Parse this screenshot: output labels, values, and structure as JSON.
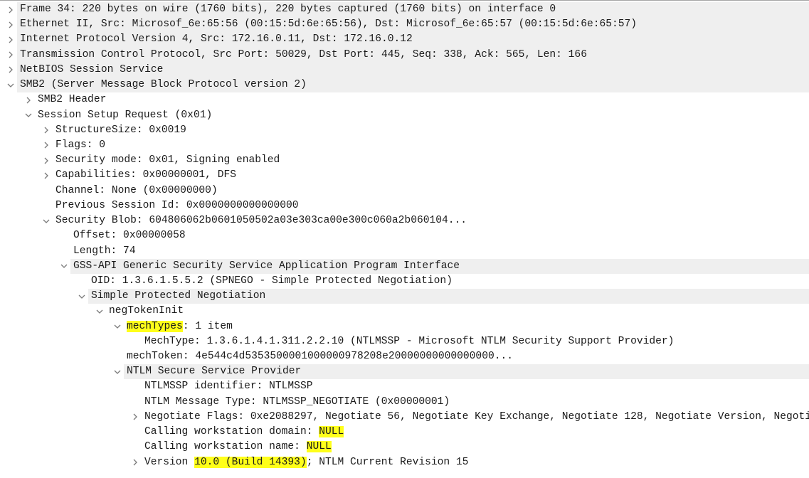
{
  "window": {
    "panel": "packet-details"
  },
  "colors": {
    "protocol_row_bg": "#efefef",
    "highlight": "#ffff1a",
    "text": "#1a1a1a",
    "chevron": "#7a7a7a"
  },
  "icons": {
    "collapsed": "chevron-right-icon",
    "expanded": "chevron-down-icon"
  },
  "tree": [
    {
      "level": 0,
      "state": "collapsed",
      "proto": true,
      "segments": [
        {
          "t": "Frame 34: 220 bytes on wire (1760 bits), 220 bytes captured (1760 bits) on interface 0"
        }
      ]
    },
    {
      "level": 0,
      "state": "collapsed",
      "proto": true,
      "segments": [
        {
          "t": "Ethernet II, Src: Microsof_6e:65:56 (00:15:5d:6e:65:56), Dst: Microsof_6e:65:57 (00:15:5d:6e:65:57)"
        }
      ]
    },
    {
      "level": 0,
      "state": "collapsed",
      "proto": true,
      "segments": [
        {
          "t": "Internet Protocol Version 4, Src: 172.16.0.11, Dst: 172.16.0.12"
        }
      ]
    },
    {
      "level": 0,
      "state": "collapsed",
      "proto": true,
      "segments": [
        {
          "t": "Transmission Control Protocol, Src Port: 50029, Dst Port: 445, Seq: 338, Ack: 565, Len: 166"
        }
      ]
    },
    {
      "level": 0,
      "state": "collapsed",
      "proto": true,
      "segments": [
        {
          "t": "NetBIOS Session Service"
        }
      ]
    },
    {
      "level": 0,
      "state": "expanded",
      "proto": true,
      "segments": [
        {
          "t": "SMB2 (Server Message Block Protocol version 2)"
        }
      ]
    },
    {
      "level": 1,
      "state": "collapsed",
      "proto": false,
      "segments": [
        {
          "t": "SMB2 Header"
        }
      ]
    },
    {
      "level": 1,
      "state": "expanded",
      "proto": false,
      "segments": [
        {
          "t": "Session Setup Request (0x01)"
        }
      ]
    },
    {
      "level": 2,
      "state": "collapsed",
      "proto": false,
      "segments": [
        {
          "t": "StructureSize: 0x0019"
        }
      ]
    },
    {
      "level": 2,
      "state": "collapsed",
      "proto": false,
      "segments": [
        {
          "t": "Flags: 0"
        }
      ]
    },
    {
      "level": 2,
      "state": "collapsed",
      "proto": false,
      "segments": [
        {
          "t": "Security mode: 0x01, Signing enabled"
        }
      ]
    },
    {
      "level": 2,
      "state": "collapsed",
      "proto": false,
      "segments": [
        {
          "t": "Capabilities: 0x00000001, DFS"
        }
      ]
    },
    {
      "level": 2,
      "state": "leaf",
      "proto": false,
      "segments": [
        {
          "t": "Channel: None (0x00000000)"
        }
      ]
    },
    {
      "level": 2,
      "state": "leaf",
      "proto": false,
      "segments": [
        {
          "t": "Previous Session Id: 0x0000000000000000"
        }
      ]
    },
    {
      "level": 2,
      "state": "expanded",
      "proto": false,
      "segments": [
        {
          "t": "Security Blob: 604806062b0601050502a03e303ca00e300c060a2b060104..."
        }
      ]
    },
    {
      "level": 3,
      "state": "leaf",
      "proto": false,
      "segments": [
        {
          "t": "Offset: 0x00000058"
        }
      ]
    },
    {
      "level": 3,
      "state": "leaf",
      "proto": false,
      "segments": [
        {
          "t": "Length: 74"
        }
      ]
    },
    {
      "level": 3,
      "state": "expanded",
      "proto": true,
      "segments": [
        {
          "t": "GSS-API Generic Security Service Application Program Interface"
        }
      ]
    },
    {
      "level": 4,
      "state": "leaf",
      "proto": false,
      "segments": [
        {
          "t": "OID: 1.3.6.1.5.5.2 (SPNEGO - Simple Protected Negotiation)"
        }
      ]
    },
    {
      "level": 4,
      "state": "expanded",
      "proto": true,
      "segments": [
        {
          "t": "Simple Protected Negotiation"
        }
      ]
    },
    {
      "level": 5,
      "state": "expanded",
      "proto": false,
      "segments": [
        {
          "t": "negTokenInit"
        }
      ]
    },
    {
      "level": 6,
      "state": "expanded",
      "proto": false,
      "segments": [
        {
          "t": "mechTypes",
          "hl": true
        },
        {
          "t": ": 1 item"
        }
      ]
    },
    {
      "level": 7,
      "state": "leaf",
      "proto": false,
      "segments": [
        {
          "t": "MechType: 1.3.6.1.4.1.311.2.2.10 (NTLMSSP - Microsoft NTLM Security Support Provider)"
        }
      ]
    },
    {
      "level": 6,
      "state": "leaf",
      "proto": false,
      "segments": [
        {
          "t": "mechToken: 4e544c4d5353500001000000978208e20000000000000000..."
        }
      ]
    },
    {
      "level": 6,
      "state": "expanded",
      "proto": true,
      "segments": [
        {
          "t": "NTLM Secure Service Provider"
        }
      ]
    },
    {
      "level": 7,
      "state": "leaf",
      "proto": false,
      "segments": [
        {
          "t": "NTLMSSP identifier: NTLMSSP"
        }
      ]
    },
    {
      "level": 7,
      "state": "leaf",
      "proto": false,
      "segments": [
        {
          "t": "NTLM Message Type: NTLMSSP_NEGOTIATE (0x00000001)"
        }
      ]
    },
    {
      "level": 7,
      "state": "collapsed",
      "proto": false,
      "segments": [
        {
          "t": "Negotiate Flags: 0xe2088297, Negotiate 56, Negotiate Key Exchange, Negotiate 128, Negotiate Version, Negoti"
        }
      ]
    },
    {
      "level": 7,
      "state": "leaf",
      "proto": false,
      "segments": [
        {
          "t": "Calling workstation domain: "
        },
        {
          "t": "NULL",
          "hl": true
        }
      ]
    },
    {
      "level": 7,
      "state": "leaf",
      "proto": false,
      "segments": [
        {
          "t": "Calling workstation name: "
        },
        {
          "t": "NULL",
          "hl": true
        }
      ]
    },
    {
      "level": 7,
      "state": "collapsed",
      "proto": false,
      "segments": [
        {
          "t": "Version "
        },
        {
          "t": "10.0 (Build 14393)",
          "hl": true
        },
        {
          "t": "; NTLM Current Revision 15"
        }
      ]
    }
  ]
}
